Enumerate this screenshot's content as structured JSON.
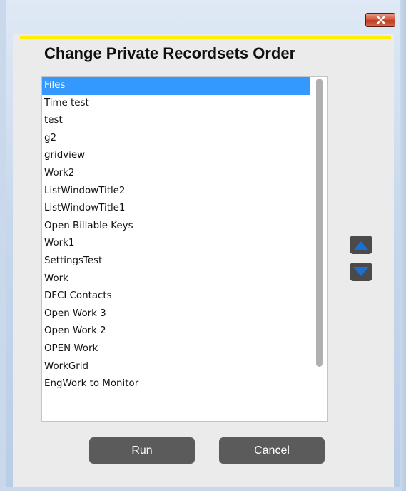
{
  "window": {
    "close_icon": "close-x-icon",
    "accent_color": "#ffee00",
    "close_color": "#c7432a"
  },
  "dialog": {
    "title": "Change Private Recordsets Order",
    "selection_color": "#3399ff"
  },
  "list": {
    "items": [
      {
        "label": "Files",
        "selected": true
      },
      {
        "label": "Time test"
      },
      {
        "label": "test"
      },
      {
        "label": "g2"
      },
      {
        "label": "gridview"
      },
      {
        "label": "Work2"
      },
      {
        "label": "ListWindowTitle2"
      },
      {
        "label": "ListWindowTitle1"
      },
      {
        "label": "Open Billable Keys"
      },
      {
        "label": "Work1"
      },
      {
        "label": "SettingsTest"
      },
      {
        "label": "Work"
      },
      {
        "label": "DFCI Contacts"
      },
      {
        "label": "Open Work 3"
      },
      {
        "label": "Open Work 2"
      },
      {
        "label": "OPEN Work"
      },
      {
        "label": "WorkGrid"
      },
      {
        "label": "EngWork to Monitor"
      }
    ]
  },
  "reorder": {
    "up_icon": "move-up-triangle-icon",
    "down_icon": "move-down-triangle-icon",
    "arrow_color": "#1a6fd1"
  },
  "buttons": {
    "run_label": "Run",
    "cancel_label": "Cancel"
  }
}
